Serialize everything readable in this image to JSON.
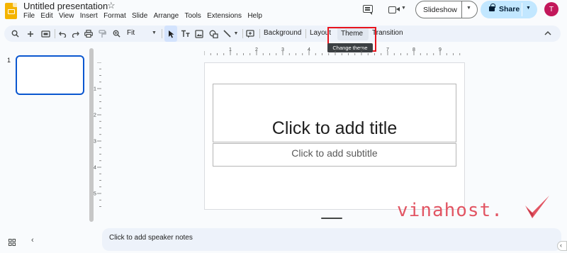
{
  "app": {
    "logo": "slides-logo",
    "title": "Untitled presentation",
    "star": "☆"
  },
  "menu": [
    "File",
    "Edit",
    "View",
    "Insert",
    "Format",
    "Slide",
    "Arrange",
    "Tools",
    "Extensions",
    "Help"
  ],
  "header": {
    "slideshow_label": "Slideshow",
    "share_label": "Share",
    "avatar_initial": "T",
    "avatar_color": "#c2185b",
    "share_color": "#c2e7ff"
  },
  "toolbar": {
    "zoom": "Fit",
    "background_label": "Background",
    "layout_label": "Layout",
    "theme_label": "Theme",
    "transition_label": "Transition",
    "tooltip": "Change theme",
    "icons": [
      "search-icon",
      "new-slide-icon",
      "slide-options-icon",
      "undo-icon",
      "redo-icon",
      "print-icon",
      "paint-format-icon",
      "zoom-icon",
      "select-icon",
      "text-box-icon",
      "image-icon",
      "shape-icon",
      "line-icon",
      "comment-add-icon",
      "collapse-icon"
    ]
  },
  "filmstrip": {
    "slide_number": "1"
  },
  "ruler": {
    "horizontal": [
      "1",
      "2",
      "3",
      "4",
      "5",
      "6",
      "7",
      "8",
      "9"
    ],
    "vertical": [
      "1",
      "2",
      "3",
      "4",
      "5"
    ]
  },
  "slide": {
    "title_placeholder": "Click to add title",
    "subtitle_placeholder": "Click to add subtitle"
  },
  "notes": {
    "placeholder": "Click to add speaker notes"
  },
  "watermark": {
    "text": "vinahost.",
    "color": "#e25563"
  },
  "highlight_color": "#e8131c"
}
